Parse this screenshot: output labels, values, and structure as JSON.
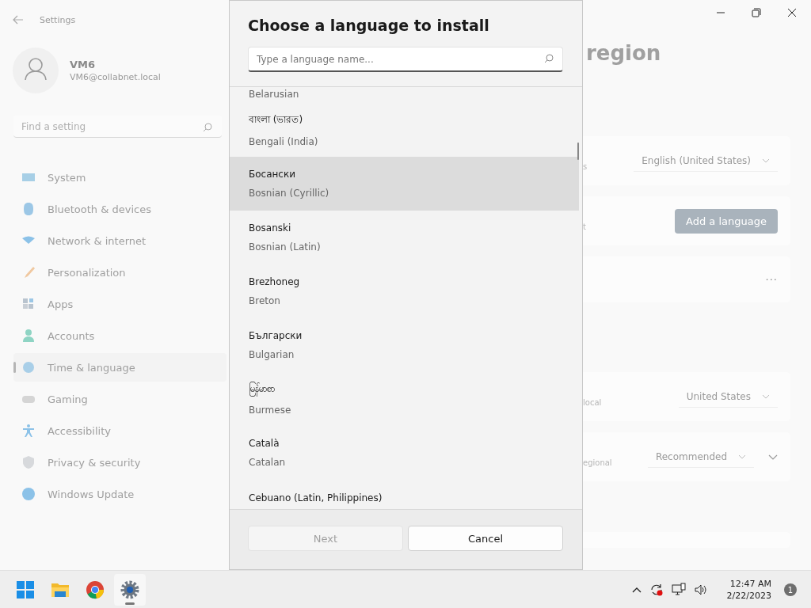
{
  "window": {
    "title": "Settings"
  },
  "account": {
    "name": "VM6",
    "email": "VM6@collabnet.local"
  },
  "sidebar": {
    "search": {
      "placeholder": "Find a setting"
    },
    "items": [
      {
        "label": "System",
        "selected": false
      },
      {
        "label": "Bluetooth & devices",
        "selected": false
      },
      {
        "label": "Network & internet",
        "selected": false
      },
      {
        "label": "Personalization",
        "selected": false
      },
      {
        "label": "Apps",
        "selected": false
      },
      {
        "label": "Accounts",
        "selected": false
      },
      {
        "label": "Time & language",
        "selected": true
      },
      {
        "label": "Gaming",
        "selected": false
      },
      {
        "label": "Accessibility",
        "selected": false
      },
      {
        "label": "Privacy & security",
        "selected": false
      },
      {
        "label": "Windows Update",
        "selected": false
      }
    ]
  },
  "page": {
    "title": "region",
    "cards": [
      {
        "kind": "dropdown",
        "label": "s",
        "value": "English (United States)",
        "expander": false
      },
      {
        "kind": "button",
        "label": "t",
        "button": "Add a language"
      },
      {
        "kind": "more",
        "more": "···"
      },
      {
        "kind": "gap"
      },
      {
        "kind": "dropdown",
        "label": "local",
        "value": "United States",
        "expander": false
      },
      {
        "kind": "dropdown",
        "label": "egional",
        "value": "Recommended",
        "expander": true
      }
    ]
  },
  "dialog": {
    "title": "Choose a language to install",
    "search": {
      "placeholder": "Type a language name..."
    },
    "languages": [
      {
        "english": "Belarusian",
        "selected": false
      },
      {
        "native": "বাংলা (ভারত)",
        "english": "Bengali (India)",
        "selected": false
      },
      {
        "native": "Босански",
        "english": "Bosnian (Cyrillic)",
        "selected": true
      },
      {
        "native": "Bosanski",
        "english": "Bosnian (Latin)",
        "selected": false
      },
      {
        "native": "Brezhoneg",
        "english": "Breton",
        "selected": false
      },
      {
        "native": "Български",
        "english": "Bulgarian",
        "selected": false
      },
      {
        "native": "မြန်မာစာ",
        "english": "Burmese",
        "selected": false
      },
      {
        "native": "Català",
        "english": "Catalan",
        "selected": false
      },
      {
        "native": "Cebuano (Latin, Philippines)",
        "selected": false
      }
    ],
    "buttons": [
      {
        "label": "Next",
        "disabled": true
      },
      {
        "label": "Cancel",
        "disabled": false
      }
    ]
  },
  "taskbar": {
    "apps": [
      {
        "active": false
      },
      {
        "active": false
      },
      {
        "active": false
      },
      {
        "active": true
      }
    ],
    "time": "12:47 AM",
    "date": "2/22/2023",
    "notifications": "1"
  }
}
